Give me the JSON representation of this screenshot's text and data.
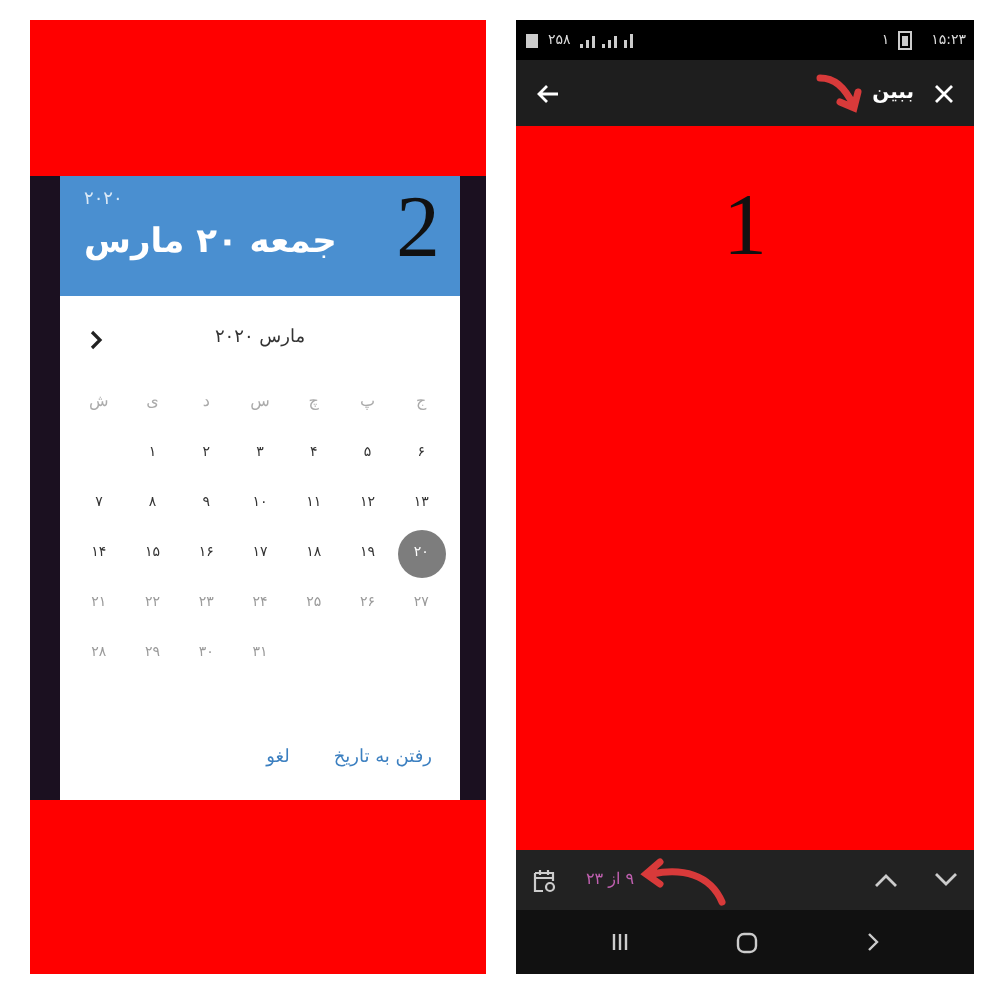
{
  "left_screen": {
    "annotation": "2",
    "dialog": {
      "year": "۲۰۲۰",
      "date": "جمعه ۲۰ مارس",
      "month": "مارس ۲۰۲۰",
      "weekdays": [
        "ج",
        "پ",
        "چ",
        "س",
        "د",
        "ی",
        "ش"
      ],
      "weeks": [
        [
          {
            "text": "۶",
            "selected": false,
            "disabled": false
          },
          {
            "text": "۵",
            "selected": false,
            "disabled": false
          },
          {
            "text": "۴",
            "selected": false,
            "disabled": false
          },
          {
            "text": "۳",
            "selected": false,
            "disabled": false
          },
          {
            "text": "۲",
            "selected": false,
            "disabled": false
          },
          {
            "text": "۱",
            "selected": false,
            "disabled": false
          }
        ],
        [
          {
            "text": "۱۳",
            "selected": false,
            "disabled": false
          },
          {
            "text": "۱۲",
            "selected": false,
            "disabled": false
          },
          {
            "text": "۱۱",
            "selected": false,
            "disabled": false
          },
          {
            "text": "۱۰",
            "selected": false,
            "disabled": false
          },
          {
            "text": "۹",
            "selected": false,
            "disabled": false
          },
          {
            "text": "۸",
            "selected": false,
            "disabled": false
          },
          {
            "text": "۷",
            "selected": false,
            "disabled": false
          }
        ],
        [
          {
            "text": "۲۰",
            "selected": true,
            "disabled": false
          },
          {
            "text": "۱۹",
            "selected": false,
            "disabled": false
          },
          {
            "text": "۱۸",
            "selected": false,
            "disabled": false
          },
          {
            "text": "۱۷",
            "selected": false,
            "disabled": false
          },
          {
            "text": "۱۶",
            "selected": false,
            "disabled": false
          },
          {
            "text": "۱۵",
            "selected": false,
            "disabled": false
          },
          {
            "text": "۱۴",
            "selected": false,
            "disabled": false
          }
        ],
        [
          {
            "text": "۲۷",
            "selected": false,
            "disabled": true
          },
          {
            "text": "۲۶",
            "selected": false,
            "disabled": true
          },
          {
            "text": "۲۵",
            "selected": false,
            "disabled": true
          },
          {
            "text": "۲۴",
            "selected": false,
            "disabled": true
          },
          {
            "text": "۲۳",
            "selected": false,
            "disabled": true
          },
          {
            "text": "۲۲",
            "selected": false,
            "disabled": true
          },
          {
            "text": "۲۱",
            "selected": false,
            "disabled": true
          }
        ],
        [
          {
            "text": "۳۱",
            "selected": false,
            "disabled": true
          },
          {
            "text": "۳۰",
            "selected": false,
            "disabled": true
          },
          {
            "text": "۲۹",
            "selected": false,
            "disabled": true
          },
          {
            "text": "۲۸",
            "selected": false,
            "disabled": true
          }
        ]
      ],
      "buttons": [
        "رفتن به تاریخ",
        "لغو"
      ]
    }
  },
  "right_screen": {
    "status_bar": {
      "network": "۲۵۸",
      "sim": "۱",
      "time": "۱۵:۲۳"
    },
    "toolbar": {
      "title": "ببین"
    },
    "annotation": "1",
    "find_bar": {
      "count": "۹ از ۲۳"
    }
  }
}
